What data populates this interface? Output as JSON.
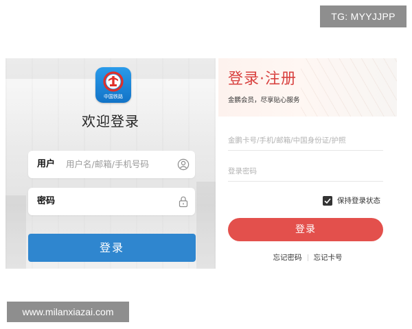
{
  "watermarks": {
    "tg": "TG: MYYJJPP",
    "site": "www.milanxiazai.com"
  },
  "railway_app": {
    "logo_text": "中国铁路",
    "welcome": "欢迎登录",
    "username": {
      "label": "用户",
      "placeholder": "用户名/邮箱/手机号码",
      "icon": "user-circle-icon"
    },
    "password": {
      "label": "密码",
      "placeholder": "",
      "icon": "lock-icon"
    },
    "login_button": "登录",
    "colors": {
      "login_button": "#2f86cf",
      "logo": "#1a86d8"
    }
  },
  "member_login": {
    "title": "登录·注册",
    "subtitle": "金鹏会员，尽享贴心服务",
    "card_placeholder": "金鹏卡号/手机/邮箱/中国身份证/护照",
    "password_placeholder": "登录密码",
    "remember_label": "保持登录状态",
    "remember_checked": true,
    "login_button": "登录",
    "forgot_password": "忘记密码",
    "forgot_card": "忘记卡号",
    "colors": {
      "title": "#d8413f",
      "login_button": "#e3504c"
    }
  }
}
